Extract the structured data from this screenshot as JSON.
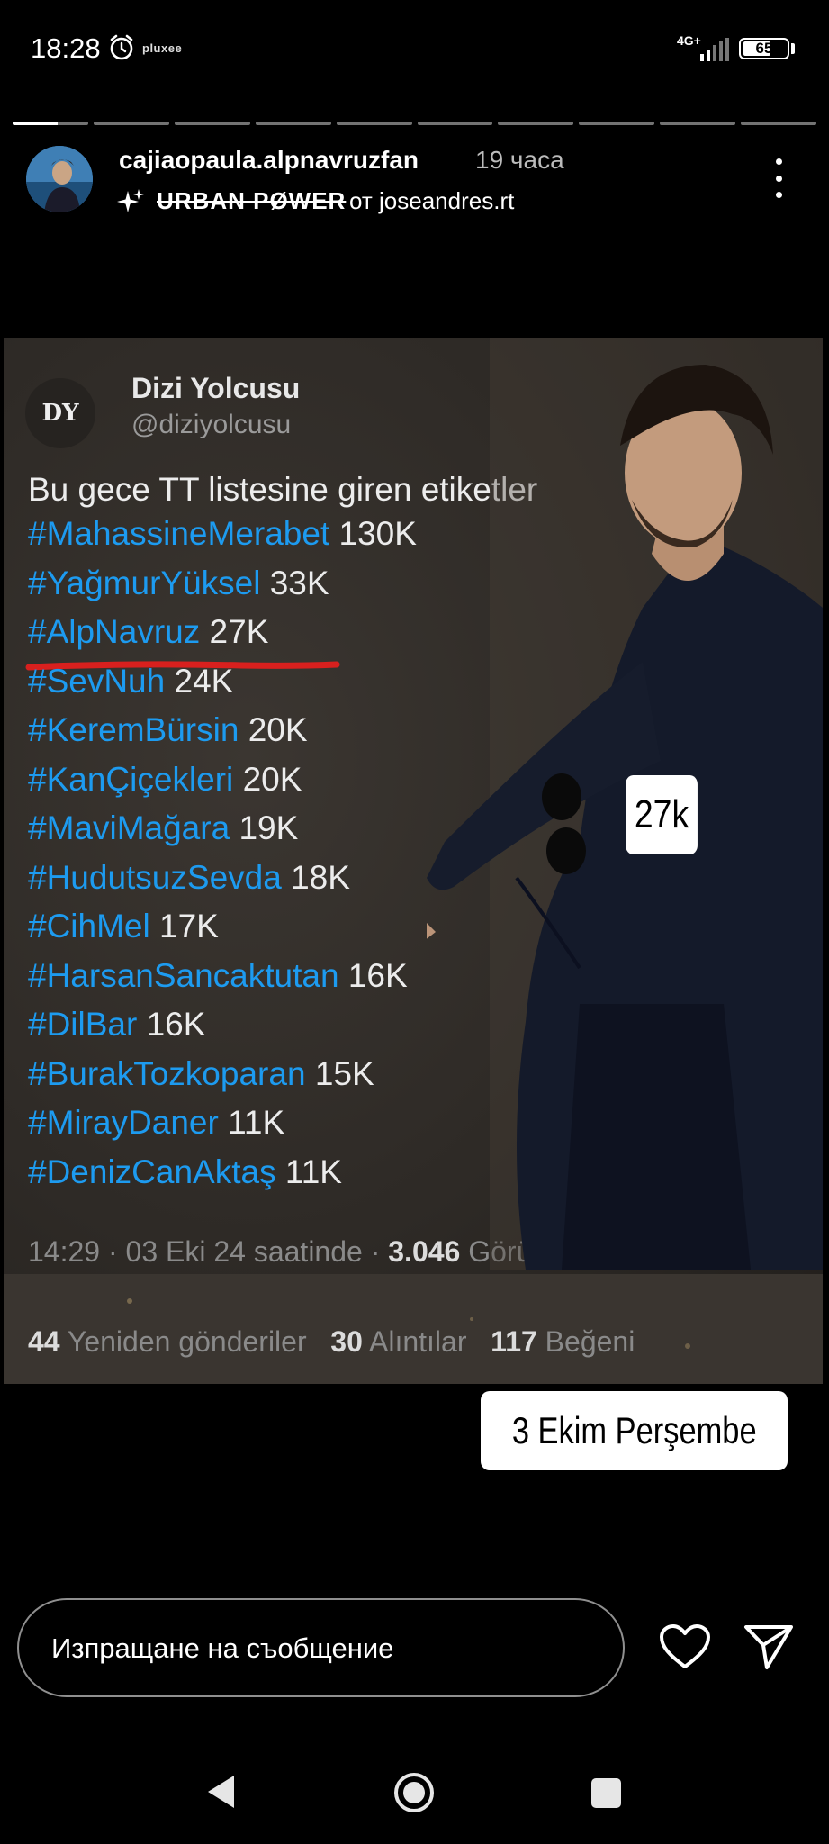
{
  "status_bar": {
    "time": "18:28",
    "app_label": "pluxee",
    "network": "4G+",
    "battery": "65",
    "battery_level": 0.65
  },
  "story_progress": {
    "segments": 10,
    "current_index": 0,
    "current_progress": 0.6
  },
  "header": {
    "username": "cajiaopaula.alpnavruzfan",
    "time_ago": "19 часа",
    "song_title": "URBAN PØWER",
    "song_attribution": "от joseandres.rt"
  },
  "tweet": {
    "logo_text": "DY",
    "display_name": "Dizi Yolcusu",
    "handle": "@diziyolcusu",
    "headline": "Bu gece TT listesine giren etiketler",
    "tags": [
      {
        "tag": "#MahassineMerabet",
        "count": "130K"
      },
      {
        "tag": "#YağmurYüksel",
        "count": "33K"
      },
      {
        "tag": "#AlpNavruz",
        "count": "27K"
      },
      {
        "tag": "#SevNuh",
        "count": "24K"
      },
      {
        "tag": "#KeremBürsin",
        "count": "20K"
      },
      {
        "tag": "#KanÇiçekleri",
        "count": "20K"
      },
      {
        "tag": "#MaviMağara",
        "count": "19K"
      },
      {
        "tag": "#HudutsuzSevda",
        "count": "18K"
      },
      {
        "tag": "#CihMel",
        "count": "17K"
      },
      {
        "tag": "#HarsanSancaktutan",
        "count": "16K"
      },
      {
        "tag": "#DilBar",
        "count": "16K"
      },
      {
        "tag": "#BurakTozkoparan",
        "count": "15K"
      },
      {
        "tag": "#MirayDaner",
        "count": "11K"
      },
      {
        "tag": "#DenizCanAktaş",
        "count": "11K"
      }
    ],
    "date_line": "14:29 · 03 Eki 24 saatinde ·",
    "views_count": "3.046",
    "views_label": "Görüntü",
    "retweets_count": "44",
    "retweets_label": "Yeniden gönderiler",
    "quotes_count": "30",
    "quotes_label": "Alıntılar",
    "likes_count": "117",
    "likes_label": "Beğeni"
  },
  "stickers": {
    "count_sticker": "27k",
    "date_sticker": "3 Ekim Perşembe"
  },
  "reply_bar": {
    "placeholder": "Изпращане на съобщение"
  },
  "colors": {
    "tag_blue": "#1d9bf0",
    "underline_red": "#d8201e",
    "background": "#000000"
  },
  "icons": [
    "alarm-icon",
    "signal-icon",
    "battery-icon",
    "sparkle-icon",
    "more-icon",
    "heart-icon",
    "send-icon",
    "back-icon",
    "home-icon",
    "recent-apps-icon"
  ]
}
